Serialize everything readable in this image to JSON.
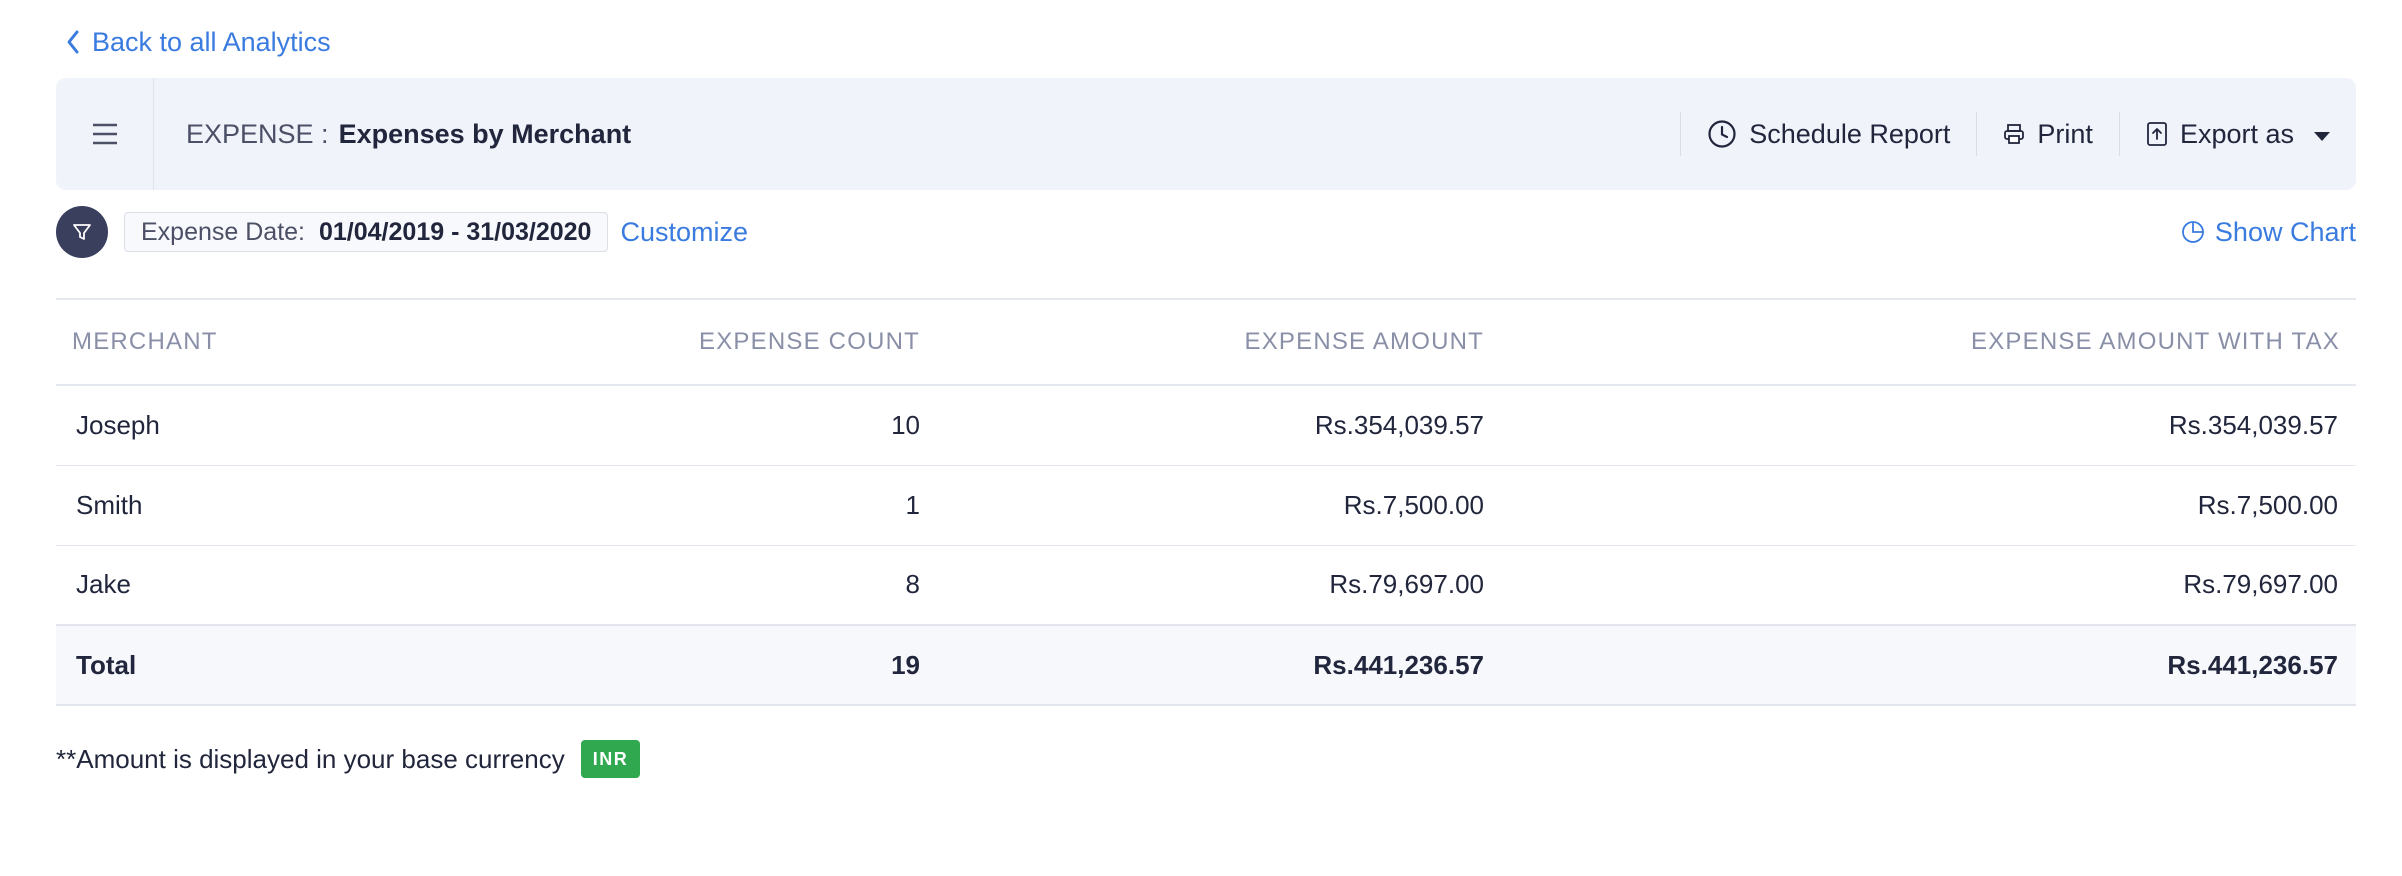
{
  "nav": {
    "back_label": "Back to all Analytics"
  },
  "header": {
    "module": "EXPENSE :",
    "report_name": "Expenses by Merchant",
    "actions": {
      "schedule": "Schedule Report",
      "print": "Print",
      "export": "Export as"
    }
  },
  "filter": {
    "label": "Expense Date:",
    "value": "01/04/2019 - 31/03/2020",
    "customize": "Customize",
    "show_chart": "Show Chart"
  },
  "table": {
    "columns": [
      "MERCHANT",
      "EXPENSE COUNT",
      "EXPENSE AMOUNT",
      "EXPENSE AMOUNT WITH TAX"
    ],
    "rows": [
      [
        "Joseph",
        "10",
        "Rs.354,039.57",
        "Rs.354,039.57"
      ],
      [
        "Smith",
        "1",
        "Rs.7,500.00",
        "Rs.7,500.00"
      ],
      [
        "Jake",
        "8",
        "Rs.79,697.00",
        "Rs.79,697.00"
      ]
    ],
    "total": [
      "Total",
      "19",
      "Rs.441,236.57",
      "Rs.441,236.57"
    ]
  },
  "footer": {
    "note": "**Amount is displayed in your base currency",
    "currency": "INR"
  },
  "colors": {
    "accent": "#3a7be0",
    "header_bg": "#f1f3fb",
    "badge": "#2fa84f",
    "filter_icon_bg": "#3a3f5e"
  },
  "icons": [
    "chevron-left-icon",
    "hamburger-menu-icon",
    "clock-icon",
    "printer-icon",
    "export-icon",
    "chevron-down-icon",
    "filter-icon",
    "pie-chart-icon"
  ]
}
